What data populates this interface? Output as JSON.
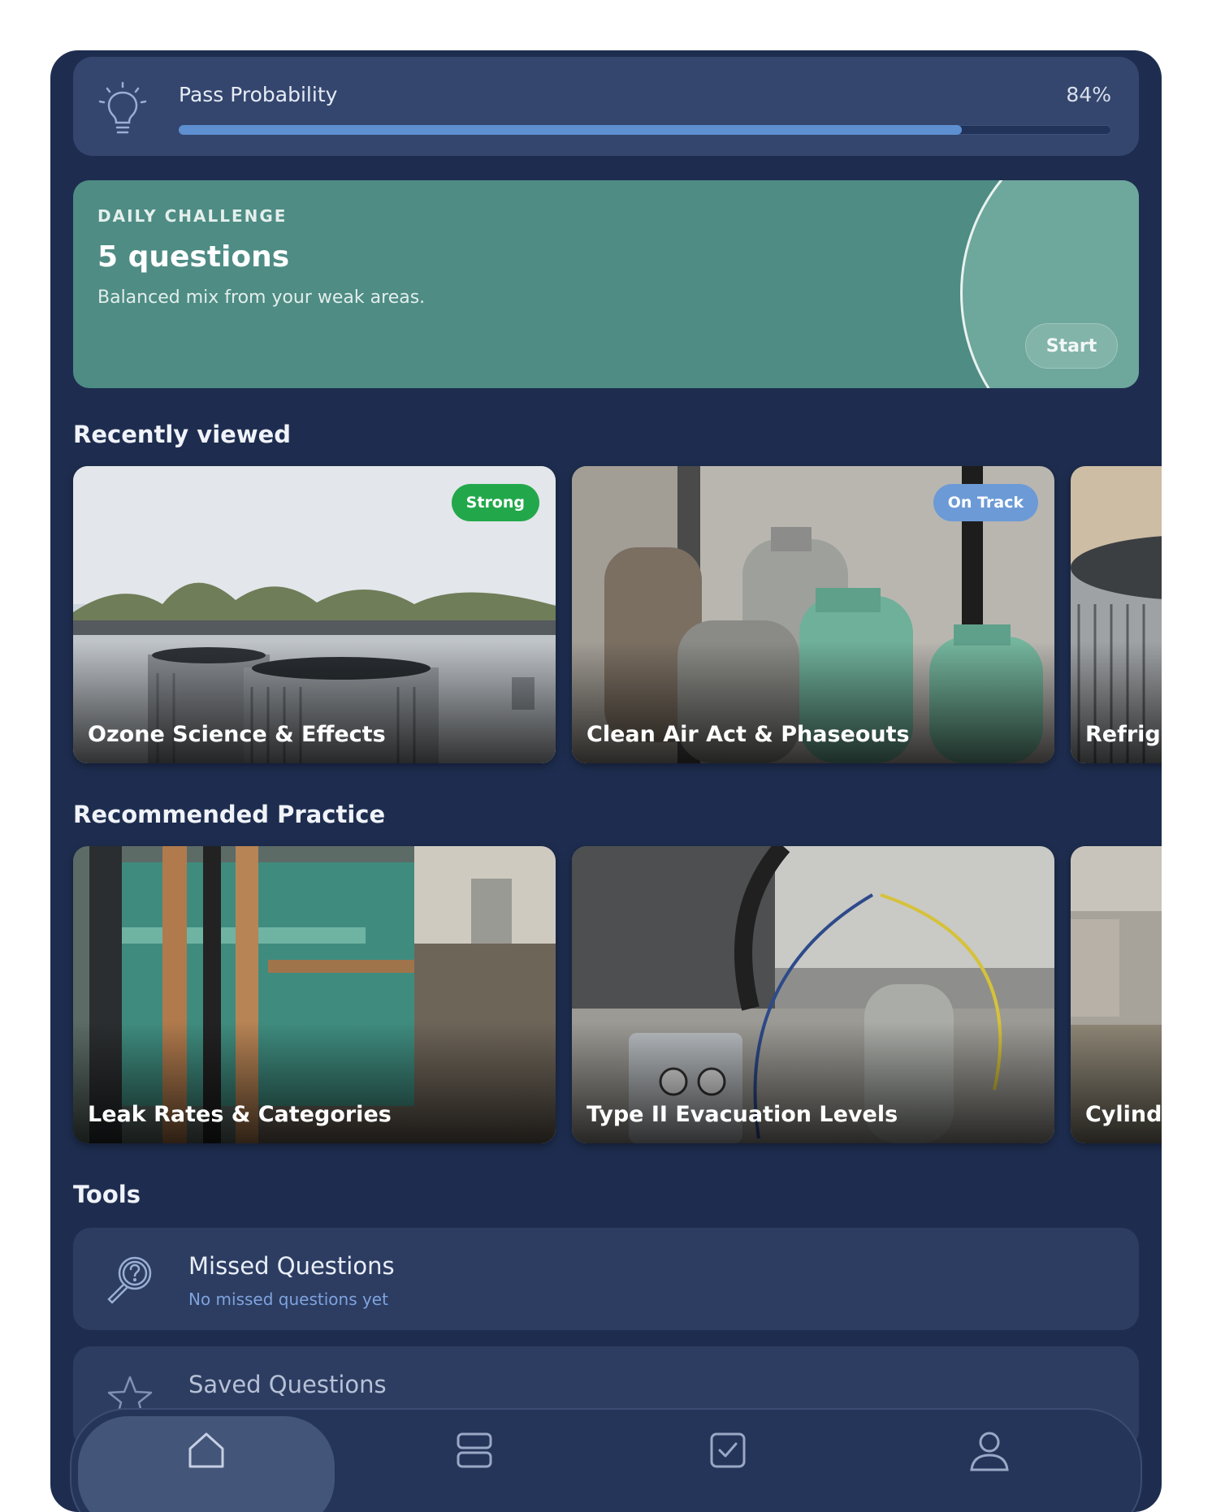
{
  "pass_probability": {
    "label": "Pass Probability",
    "value_text": "84%",
    "value": 0.84,
    "icon": "lightbulb-icon"
  },
  "daily_challenge": {
    "eyebrow": "DAILY CHALLENGE",
    "title": "5 questions",
    "subtitle": "Balanced mix from your weak areas.",
    "start_label": "Start"
  },
  "recently_viewed": {
    "title": "Recently viewed",
    "cards": [
      {
        "label": "Ozone Science & Effects",
        "badge": "Strong"
      },
      {
        "label": "Clean Air Act & Phaseouts",
        "badge": "On Track"
      },
      {
        "label": "Refrige"
      }
    ]
  },
  "recommended": {
    "title": "Recommended Practice",
    "cards": [
      {
        "label": "Leak Rates & Categories"
      },
      {
        "label": "Type II Evacuation Levels"
      },
      {
        "label": "Cylinde"
      }
    ]
  },
  "tools": {
    "title": "Tools",
    "items": [
      {
        "title": "Missed Questions",
        "subtitle": "No missed questions yet",
        "icon": "search-question-icon"
      },
      {
        "title": "Saved Questions",
        "icon": "star-icon"
      }
    ]
  },
  "tabbar": {
    "tabs": [
      {
        "icon": "home-icon",
        "active": true
      },
      {
        "icon": "stack-icon"
      },
      {
        "icon": "checkbox-icon"
      },
      {
        "icon": "profile-icon"
      }
    ]
  },
  "colors": {
    "app_background": "#1e2d4f",
    "progress_fill": "#5e8fd0",
    "challenge": "#4e8c84",
    "badge_strong": "#22a84b",
    "badge_on_track": "#6b9ad6"
  }
}
